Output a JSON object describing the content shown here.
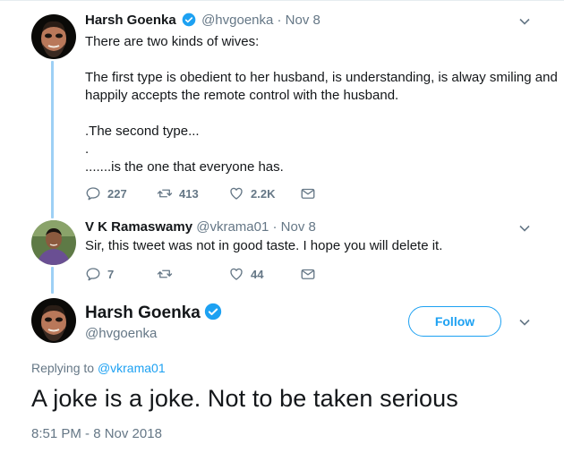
{
  "thread": {
    "tweet1": {
      "name": "Harsh Goenka",
      "handle": "@hvgoenka",
      "date": "· Nov 8",
      "lines": [
        "There are two kinds of wives:",
        "",
        "The first type is obedient to her husband, is understanding, is alway  smiling and",
        "happily accepts the remote control with the husband.",
        "",
        ".The second type...",
        ".",
        ".......is the one that everyone has."
      ],
      "replies": "227",
      "retweets": "413",
      "likes": "2.2K"
    },
    "tweet2": {
      "name": "V K Ramaswamy",
      "handle": "@vkrama01",
      "date": "· Nov 8",
      "text": "Sir, this tweet was not in good taste. I hope you will delete it.",
      "replies": "7",
      "retweets": "",
      "likes": "44"
    }
  },
  "main_tweet": {
    "name": "Harsh Goenka",
    "handle": "@hvgoenka",
    "follow_label": "Follow",
    "replying_prefix": "Replying to",
    "replying_to": "@vkrama01",
    "text": "A joke is a joke. Not to be taken serious",
    "timestamp": "8:51 PM - 8 Nov 2018"
  },
  "colors": {
    "brand_blue": "#1da1f2",
    "thread_line": "#9ed0f5",
    "secondary_text": "#657786"
  },
  "icons": [
    "verified-badge-icon",
    "chevron-down-icon",
    "reply-icon",
    "retweet-icon",
    "like-icon",
    "direct-message-icon"
  ]
}
